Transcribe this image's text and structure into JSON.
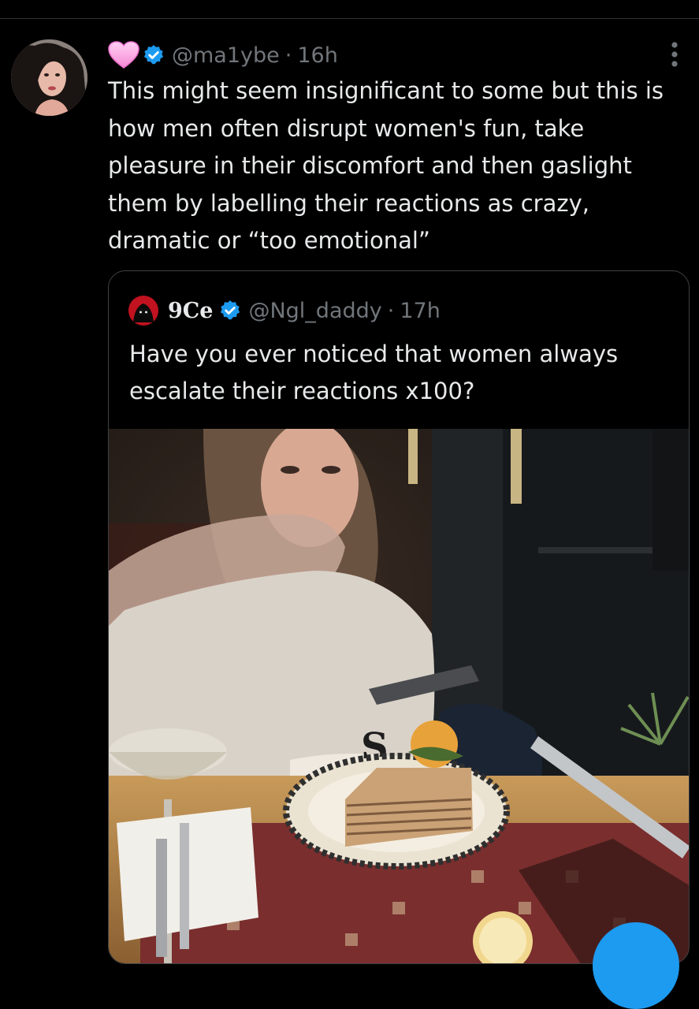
{
  "tweet": {
    "handle": "@ma1ybe",
    "separator": "·",
    "time": "16h",
    "text": "This might seem insignificant to some but this is how men often disrupt women's fun, take pleasure in their discomfort and then gaslight them by labelling their reactions as crazy, dramatic or “too emotional”",
    "icons": [
      "heart-emoji-icon",
      "verified-badge-icon",
      "more-options-icon"
    ]
  },
  "quoted_tweet": {
    "display_name": "9Ce",
    "handle": "@Ngl_daddy",
    "separator": "·",
    "time": "17h",
    "text": "Have you ever noticed that women always escalate their reactions x100?"
  },
  "colors": {
    "background": "#000000",
    "text_primary": "#e7e9ea",
    "text_secondary": "#71767b",
    "verified_blue": "#1d9bf0",
    "heart_pink": "#f7a8e0",
    "border": "#3e4144"
  }
}
